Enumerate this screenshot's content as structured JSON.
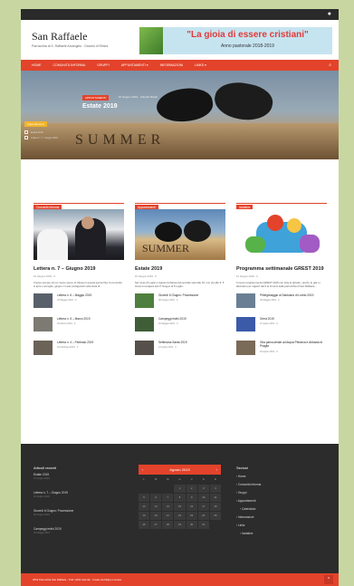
{
  "site": {
    "title": "San Raffaele",
    "description": "Parrocchia di S. Raffaele Arcangelo · Diocesi di Rimini"
  },
  "banner": {
    "headline": "\"La gioia di essere cristiani\"",
    "subline": "Anno pastorale 2018-2019"
  },
  "nav": {
    "items": [
      "Home",
      "Comunità Informa",
      "Gruppi",
      "Appuntamenti ▾",
      "Informazioni",
      "Links ▾"
    ],
    "search_icon": "search-icon"
  },
  "hero": {
    "category": "APPUNTAMENTI",
    "meta": "· 10 Giugno 2019 · Claudio Molari",
    "title": "Estate 2019",
    "badge": "Appuntamenti",
    "mini1": "Estate 2019",
    "mini2": "Lettera n. 7 – Giugno 2019",
    "tiles": "SUMMER"
  },
  "columns": [
    {
      "heading": "Comunità Informa",
      "featured": {
        "title": "Lettera n. 7 – Giugno 2019",
        "meta": "10 Giugno 2019 · 0",
        "excerpt": "Cresce sempre più un nuovo senso di chiesa in questa parrocchia: la comunità si apre e accoglie, giugno ci vede protagonisti nella festa di..."
      },
      "list": [
        {
          "title": "Lettera n. 6 – Maggio 2019",
          "meta": "15 Maggio 2019 · 0"
        },
        {
          "title": "Lettera n. 5 – Marzo 2019",
          "meta": "18 Marzo 2019 · 0"
        },
        {
          "title": "Lettera n. 4 – Febbraio 2019",
          "meta": "16 Febbraio 2019 · 0"
        }
      ]
    },
    {
      "heading": "Appuntamenti",
      "featured": {
        "title": "Estate 2019",
        "meta": "10 Giugno 2019 · 0",
        "excerpt": "Nel mese di Luglio e Agosto la Messa domenicale sarà alle 10, non più alle 9. Il Grest si svolgerà dal 17 Giugno al 5 Luglio..."
      },
      "list": [
        {
          "title": "Giovedì 6 Giugno: Processione",
          "meta": "06 Giugno 2019 · 0"
        },
        {
          "title": "Campeggi estivi 2019",
          "meta": "20 Maggio 2019 · 0"
        },
        {
          "title": "Settimana Santa 2019",
          "meta": "13 Aprile 2019 · 0"
        }
      ]
    },
    {
      "heading": "Iniziative",
      "featured": {
        "title": "Programma settimanale GREST 2019",
        "meta": "12 Giugno 2019 · 0",
        "excerpt": "Il nuovo programma del GREST 2019 con tutte le attività, i giochi, le gite e i laboratori per ragazzi dai 6 ai 13 anni della parrocchia di San Raffaele..."
      },
      "list": [
        {
          "title": "Pellegrinaggio al Santuario di Loreto 2019",
          "meta": "25 Maggio 2019 · 0"
        },
        {
          "title": "Grest 2019",
          "meta": "27 Aprile 2019 · 0"
        },
        {
          "title": "Gita parrocchiale ad Arquà Petrarca e Abbazia di Praglia",
          "meta": "20 Aprile 2019 · 0"
        }
      ]
    }
  ],
  "footer": {
    "recent_heading": "Articoli recenti",
    "recent": [
      {
        "title": "Estate 2019",
        "date": "10 Giugno 2019"
      },
      {
        "title": "Lettera n. 7 – Giugno 2019",
        "date": "10 Giugno 2019"
      },
      {
        "title": "Giovedì 6 Giugno: Processione",
        "date": "06 Giugno 2019"
      },
      {
        "title": "Campeggi estivi 2019",
        "date": "20 Maggio 2019"
      }
    ],
    "calendar": {
      "month": "Agosto 2019",
      "weekdays": [
        "L",
        "M",
        "M",
        "G",
        "V",
        "S",
        "D"
      ],
      "days": [
        "",
        "",
        "",
        "1",
        "2",
        "3",
        "4",
        "5",
        "6",
        "7",
        "8",
        "9",
        "10",
        "11",
        "12",
        "13",
        "14",
        "15",
        "16",
        "17",
        "18",
        "19",
        "20",
        "21",
        "22",
        "23",
        "24",
        "25",
        "26",
        "27",
        "28",
        "29",
        "30",
        "31",
        ""
      ]
    },
    "links_heading": "Sezioni",
    "links": [
      "Home",
      "Comunità Informa",
      "Gruppi",
      "Appuntamenti",
      "Calendario",
      "Informazioni",
      "Links",
      "Iniziative"
    ],
    "copyright": "2019 Parrocchia San Raffaele - Tutti i diritti riservati · Creato da Filippo Lorusso"
  },
  "colors": {
    "accent": "#e3432b",
    "footer": "#2c2c2c",
    "background": "#c8d7a1"
  }
}
